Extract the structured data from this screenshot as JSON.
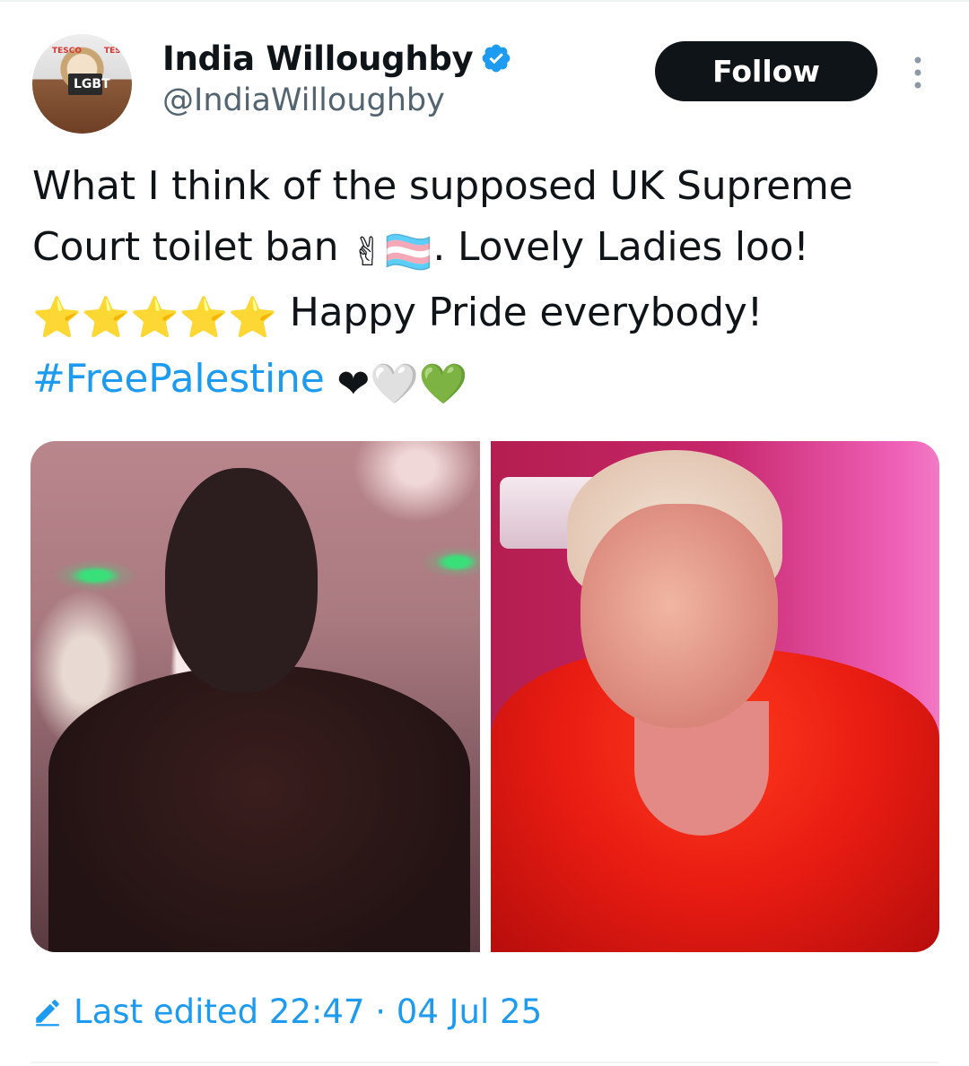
{
  "author": {
    "display_name": "India Willoughby",
    "handle": "@IndiaWilloughby",
    "verified": true,
    "avatar_sign_text": "LGBT",
    "avatar_brand_text": "TESCO"
  },
  "header": {
    "follow_label": "Follow",
    "more_icon": "more-vertical-icon"
  },
  "tweet": {
    "line1": "What I think of the supposed UK Supreme",
    "line2_text": "Court toilet ban ",
    "line2_emojis": "✌🏳️‍⚧️",
    "line2_tail": ". Lovely Ladies loo!",
    "line3_emojis": "⭐⭐⭐⭐⭐",
    "line3_text": " Happy Pride everybody!",
    "hashtag": "#FreePalestine",
    "hashtag_emojis": "❤🤍💚"
  },
  "media": {
    "count": 2,
    "left_description": "silhouette selfie in pink-lit restroom",
    "right_description": "selfie in red top in pink restroom"
  },
  "footer": {
    "edited_label": "Last edited 22:47 · 04 Jul 25"
  },
  "colors": {
    "text": "#0f1419",
    "secondary": "#536471",
    "accent": "#1d9bf0",
    "follow_bg": "#0f1419",
    "divider": "#eff3f4"
  }
}
